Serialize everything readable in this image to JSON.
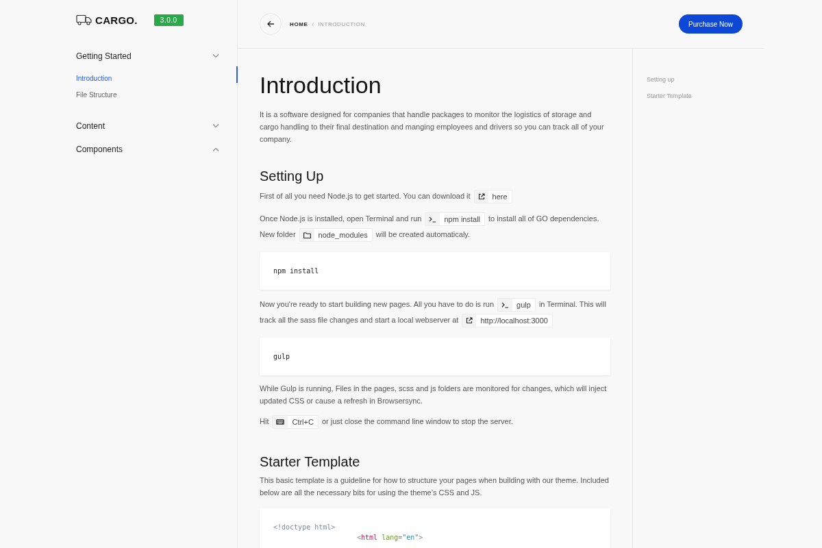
{
  "sidebar": {
    "logo": "CARGO.",
    "version": "3.0.0",
    "groups": [
      {
        "label": "Getting Started",
        "expanded": false,
        "children": [
          {
            "label": "Introduction",
            "selected": true
          },
          {
            "label": "File Structure",
            "selected": false
          }
        ]
      },
      {
        "label": "Content",
        "expanded": false
      },
      {
        "label": "Components",
        "expanded": true
      }
    ]
  },
  "header": {
    "breadcrumb": [
      {
        "label": "HOME",
        "current": false
      },
      {
        "label": "INTRODUCTION",
        "current": true
      }
    ],
    "separator": "/",
    "action": "Purchase Now"
  },
  "title": "Introduction",
  "intro": "It is a software designed for companies that handle packages to monitor the logistics of storage and cargo handling to their final destination and manging employees and drivers so you can track all of your company.",
  "sections": [
    {
      "heading": "Setting Up",
      "blocks": [
        {
          "kind": "paragraph",
          "parts": [
            {
              "kind": "text",
              "text": "First of all you need Node.js to get started. You can download it"
            },
            {
              "kind": "link-chip",
              "text": "here"
            }
          ]
        },
        {
          "kind": "paragraph",
          "parts": [
            {
              "kind": "text",
              "text": "Once Node.js is installed, open Terminal and run"
            },
            {
              "kind": "command-chip",
              "text": "npm install"
            },
            {
              "kind": "text",
              "text": "to install all of GO dependencies. New folder"
            },
            {
              "kind": "folder-chip",
              "text": "node_modules"
            },
            {
              "kind": "text",
              "text": "will be created automaticaly."
            }
          ]
        },
        {
          "kind": "code",
          "lines": [
            {
              "indented": false,
              "tokens": [
                {
                  "kind": "plain",
                  "text": "npm install"
                }
              ]
            }
          ]
        },
        {
          "kind": "paragraph",
          "parts": [
            {
              "kind": "text",
              "text": "Now you're ready to start building new pages. All you have to do is run"
            },
            {
              "kind": "command-chip",
              "text": "gulp"
            },
            {
              "kind": "text",
              "text": "in Terminal. This will track all the sass file changes and start a local webserver at"
            },
            {
              "kind": "link-chip",
              "text": "http://localhost:3000"
            }
          ]
        },
        {
          "kind": "code",
          "lines": [
            {
              "indented": false,
              "tokens": [
                {
                  "kind": "plain",
                  "text": "gulp"
                }
              ]
            }
          ]
        },
        {
          "kind": "paragraph",
          "parts": [
            {
              "kind": "text",
              "text": "While Gulp is running, Files in the pages, scss and js folders are monitored for changes, which will inject updated CSS or cause a refresh in Browsersync."
            }
          ]
        },
        {
          "kind": "paragraph",
          "parts": [
            {
              "kind": "text",
              "text": "Hit"
            },
            {
              "kind": "key-chip",
              "text": "Ctrl+C"
            },
            {
              "kind": "text",
              "text": "or just close the command line window to stop the server."
            }
          ]
        }
      ]
    },
    {
      "heading": "Starter Template",
      "blocks": [
        {
          "kind": "paragraph",
          "parts": [
            {
              "kind": "text",
              "text": "This basic template is a guideline for how to structure your pages when building with our theme. Included below are all the necessary bits for using the theme’s CSS and JS."
            }
          ]
        },
        {
          "kind": "code",
          "lines": [
            {
              "indented": false,
              "tokens": [
                {
                  "kind": "doctype",
                  "text": "<!doctype html>"
                }
              ]
            },
            {
              "indented": true,
              "tokens": [
                {
                  "kind": "punct",
                  "text": "<"
                },
                {
                  "kind": "tag",
                  "text": "html"
                },
                {
                  "kind": "attr",
                  "text": " lang"
                },
                {
                  "kind": "punct",
                  "text": "="
                },
                {
                  "kind": "string",
                  "text": "\"en\""
                },
                {
                  "kind": "punct",
                  "text": ">"
                }
              ]
            }
          ]
        }
      ]
    }
  ],
  "toc": [
    {
      "label": "Setting up"
    },
    {
      "label": "Starter Template"
    }
  ]
}
